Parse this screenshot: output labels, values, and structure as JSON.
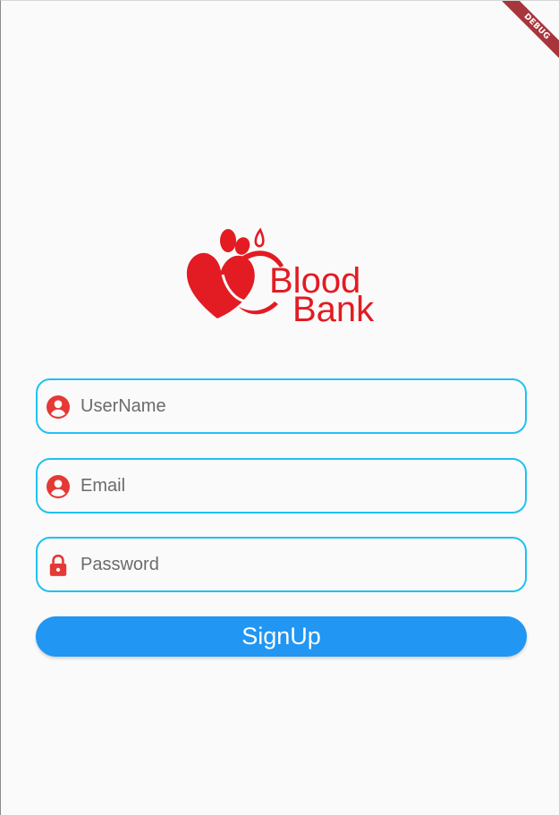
{
  "debug_banner": {
    "label": "DEBUG"
  },
  "logo": {
    "line1": "Blood",
    "line2": "Bank"
  },
  "form": {
    "username": {
      "placeholder": "UserName",
      "icon": "account-circle-icon"
    },
    "email": {
      "placeholder": "Email",
      "icon": "account-circle-icon"
    },
    "password": {
      "placeholder": "Password",
      "icon": "lock-icon"
    }
  },
  "signup_button": {
    "label": "SignUp"
  },
  "colors": {
    "accent_border": "#1ec2f0",
    "icon_red": "#e53935",
    "button_blue": "#2196f3",
    "logo_red": "#e31b23"
  }
}
